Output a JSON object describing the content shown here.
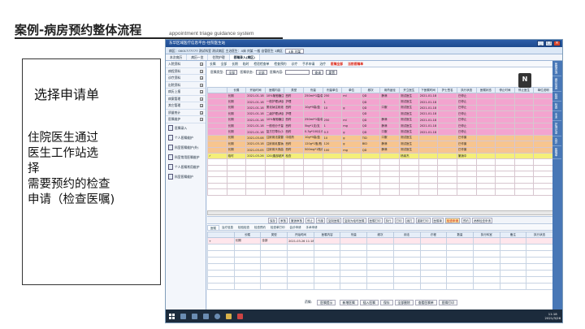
{
  "slide": {
    "title": "案例-病房预约整体流程",
    "subtitle": "appointment triage guidance system",
    "note_title": "选择申请单",
    "note_lines": [
      "住院医生通过",
      "医生工作站选",
      "择",
      "需要预约的检查",
      "申请（检查医嘱)"
    ]
  },
  "app": {
    "window_title": "东华区域医疗信息平台-住院医生站",
    "window_buttons": [
      "_",
      "□",
      "×"
    ],
    "appbar_text": "病区：0001777777  测试科室  测试病区  主治医生：4床 刘某 一般 自管医生 1病区",
    "appbar_pill": "4床 刘某",
    "module_tabs": [
      "本次病历",
      "病历一览",
      "住院护理",
      "医嘱录入(病区)"
    ],
    "left_menu": [
      {
        "label": "入院资料"
      },
      {
        "label": "病程资料"
      },
      {
        "label": "诊疗资料"
      },
      {
        "label": "出院资料"
      },
      {
        "label": "病历上报"
      },
      {
        "label": "病案管理"
      },
      {
        "label": "其它管理"
      },
      {
        "label": "质量统计"
      },
      {
        "label": "医嘱维护"
      }
    ],
    "left_subs": [
      "医嘱录入",
      "个人医嘱维护",
      "科室医嘱维护(外)",
      "科室常用医嘱维护",
      "个人医嘱常用维护",
      "科室医嘱维护"
    ],
    "sub_tabs": [
      {
        "label": "长嘱"
      },
      {
        "label": "全部"
      },
      {
        "label": "长期"
      },
      {
        "label": "临时"
      },
      {
        "label": "检验检查单"
      },
      {
        "label": "检查预约"
      },
      {
        "label": "诊疗"
      },
      {
        "label": "手术申请"
      },
      {
        "label": "治疗"
      },
      {
        "label": "医嘱全部",
        "red": true
      },
      {
        "label": "当前医嘱单",
        "red": true
      }
    ],
    "filter": {
      "label1": "医嘱类型:",
      "value1": "全部",
      "label2": "医嘱状态:",
      "value2": "全部",
      "label3": "医嘱内容:",
      "btn1": "查询",
      "btn2": "重置"
    },
    "columns": [
      "",
      "长嘱",
      "开始时间",
      "医嘱内容",
      "类型",
      "剂量",
      "剂量单位",
      "单位",
      "频次",
      "用药途径",
      "开立医生",
      "下医嘱时间",
      "护士签名",
      "执行状态",
      "医嘱状态",
      "停止时间",
      "停止医生",
      "单位说明"
    ],
    "rows": [
      {
        "color": "pink",
        "cells": [
          "",
          "长期",
          "2021-01-18 11:18",
          "10%葡萄糖注射液(250ml)",
          "西药",
          "250ml*1袋/袋",
          "250",
          "ml",
          "QD",
          "静滴",
          "测试医生",
          "2021-01-18 11:18",
          "",
          "已停止",
          "",
          "",
          "",
          ""
        ]
      },
      {
        "color": "pink",
        "cells": [
          "",
          "长期",
          "2021-01-18 11:18",
          "一般护理(病区)",
          "护理",
          "",
          "1",
          "",
          "QD",
          "",
          "测试医生",
          "2021-01-18 11:18",
          "",
          "已停止",
          "",
          "",
          "",
          ""
        ]
      },
      {
        "color": "pink",
        "cells": [
          "",
          "长期",
          "2021-01-18 11:20",
          "氯化钠注射液",
          "西药",
          "10g*9袋/盒",
          "10",
          "g",
          "QD",
          "口服",
          "测试医生",
          "2021-01-18 11:20",
          "",
          "已停止",
          "",
          "",
          "",
          ""
        ]
      },
      {
        "color": "pink",
        "cells": [
          "",
          "长期",
          "2021-01-18 11:22",
          "二级护理(病区)",
          "护理",
          "",
          "",
          "",
          "QD",
          "",
          "测试医生",
          "2021-01-18 11:22",
          "",
          "已停止",
          "",
          "",
          "",
          ""
        ]
      },
      {
        "color": "pink",
        "cells": [
          "",
          "长期",
          "2021-01-18 11:22",
          "10%葡萄糖注射液(250ml)",
          "西药",
          "250ml*1袋/袋",
          "250",
          "ml",
          "QD",
          "静滴",
          "测试医生",
          "2021-01-18 11:22",
          "",
          "已停止",
          "",
          "",
          "",
          ""
        ]
      },
      {
        "color": "pink",
        "cells": [
          "",
          "长期",
          "2021-01-18 11:22",
          "一般低分子量肝素钙",
          "西药",
          "5kg*1支/支",
          "1",
          "mg",
          "QD",
          "静滴",
          "测试医生",
          "2021-01-18 11:22",
          "",
          "已停止",
          "",
          "",
          "",
          ""
        ]
      },
      {
        "color": "pink",
        "cells": [
          "",
          "长期",
          "2021-01-18 11:22",
          "复方甘草片(100片)",
          "西药",
          "0.3g*100片/瓶",
          "0.3",
          "g",
          "QD",
          "口服",
          "测试医生",
          "2021-01-18 11:22",
          "",
          "已停止",
          "",
          "",
          "",
          ""
        ]
      },
      {
        "color": "orange",
        "cells": [
          "",
          "长期",
          "2021-03-08 13:50",
          "注射用法莫替丁 TID 口服",
          "中成药",
          "10g*9袋/盒",
          "10",
          "g",
          "TID",
          "口服",
          "测试医生",
          "",
          "",
          "已作废",
          "",
          "",
          "",
          ""
        ]
      },
      {
        "color": "orange",
        "cells": [
          "",
          "长期",
          "2021-03-18 10:09",
          "注射用乳酸钠林格 BID 静滴",
          "西药",
          "120g*1瓶/瓶",
          "120",
          "g",
          "BID",
          "静滴",
          "测试医生",
          "",
          "",
          "已作废",
          "",
          "",
          "",
          ""
        ]
      },
      {
        "color": "orange",
        "cells": [
          "",
          "长期",
          "2021-03-05 14:58",
          "注射用头孢曲松钠(0.5g)",
          "西药",
          "500mg*1瓶/瓶",
          "100",
          "mg",
          "QD",
          "静滴",
          "测试医生",
          "",
          "",
          "已作废",
          "",
          "",
          "",
          ""
        ]
      },
      {
        "color": "yellow",
        "cells": [
          "✓",
          "临时",
          "2021-03-26 11:18",
          "120(腹部超声检查(CT))",
          "检查",
          "",
          "",
          "",
          "",
          "",
          "杨某杰",
          "",
          "",
          "撤销中",
          "",
          "",
          "",
          ""
        ]
      }
    ],
    "action_buttons": [
      {
        "label": "保存"
      },
      {
        "label": "审核"
      },
      {
        "label": "撤销审核"
      },
      {
        "label": "停止"
      },
      {
        "label": "作废"
      },
      {
        "label": "复制医嘱"
      },
      {
        "label": "复制为临时医嘱"
      },
      {
        "label": "医嘱打印"
      },
      {
        "label": "执行"
      },
      {
        "label": "打印"
      },
      {
        "label": "续打"
      },
      {
        "label": "重新打印"
      },
      {
        "label": "医嘱单"
      },
      {
        "label": "检查申请",
        "hl": true
      },
      {
        "label": "预约"
      },
      {
        "label": "病种检查申请"
      }
    ],
    "bottom_tabs": [
      "医嘱",
      "治疗信息",
      "检验检查",
      "检查预约",
      "检查单打印",
      "会诊申请",
      "手术申请"
    ],
    "edit_columns": [
      "",
      "长嘱",
      "类型",
      "开始时间",
      "医嘱内容",
      "剂量",
      "频次",
      "用法",
      "疗程",
      "数量",
      "执行科室",
      "备注",
      "执行状态"
    ],
    "edit_row": [
      "+",
      "长期",
      "全部",
      "2021-03-26 11:18",
      "",
      "",
      "",
      "",
      "",
      "",
      "",
      "",
      ""
    ],
    "bottom_bar": {
      "label": "药嘱:",
      "value": "医嘱提示",
      "buttons": [
        "新增医嘱",
        "插入医嘱",
        "保存",
        "全部删除",
        "查看医嘱单",
        "医嘱打印"
      ]
    },
    "taskbar_clock": {
      "time": "11:18",
      "date": "2021/3/26"
    },
    "right_side_tabs": [
      "医嘱查询",
      "病历信息",
      "检验",
      "检查",
      "手术",
      "护理记录",
      "会诊",
      "医嘱单"
    ]
  }
}
